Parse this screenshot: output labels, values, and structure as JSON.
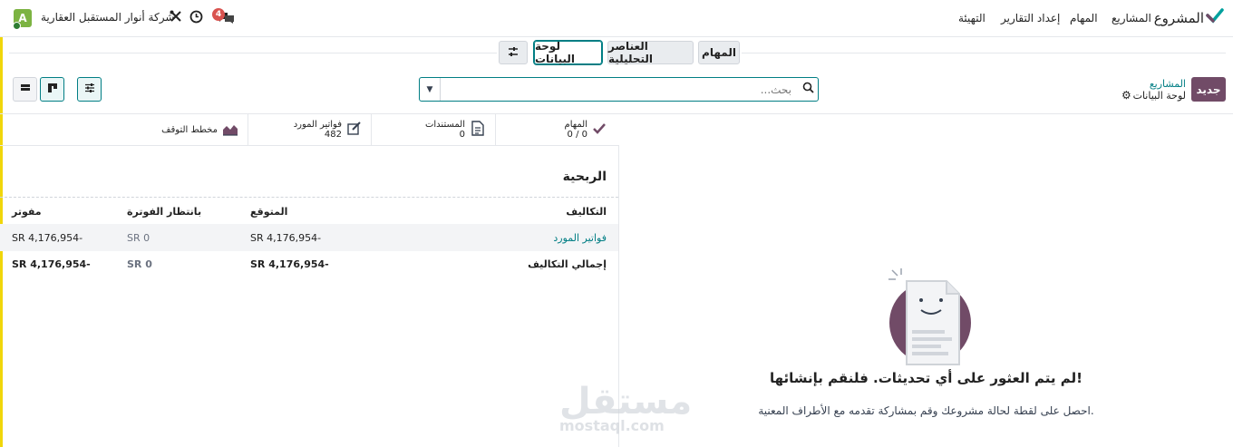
{
  "topbar": {
    "avatar_initial": "A",
    "company": "شركة أنوار المستقبل العقارية",
    "message_count": "4",
    "brand": "المشروع",
    "nav": [
      "المشاريع",
      "المهام",
      "إعداد التقارير",
      "التهيئة"
    ],
    "icons": [
      "messages-icon",
      "clock-icon",
      "tools-icon"
    ]
  },
  "view_tabs": {
    "tasks": "المهام",
    "analytic": "العناصر التحليلية",
    "dashboard": "لوحة البيانات",
    "settings_icon": "sliders-icon"
  },
  "control": {
    "new_button": "جديد",
    "breadcrumb_parent": "المشاريع",
    "breadcrumb_current": "لوحة البيانات",
    "search_placeholder": "بحث..."
  },
  "stats": [
    {
      "label": "المهام",
      "value": "0 / 0",
      "icon": "check-icon"
    },
    {
      "label": "المستندات",
      "value": "0",
      "icon": "document-icon"
    },
    {
      "label": "فواتير المورد",
      "value": "482",
      "icon": "edit-icon"
    },
    {
      "label": "مخطط التوقف",
      "value": "",
      "icon": "area-chart-icon"
    }
  ],
  "profitability": {
    "title": "الربحية",
    "headers": {
      "costs": "التكاليف",
      "expected": "المتوقع",
      "to_invoice": "بانتظار الفوترة",
      "invoiced": "مفوتر"
    },
    "rows": [
      {
        "label": "فواتير المورد",
        "expected": "SR 4,176,954-",
        "to_invoice": "SR 0",
        "invoiced": "SR 4,176,954-"
      }
    ],
    "total": {
      "label": "إجمالي التكاليف",
      "expected": "SR 4,176,954-",
      "to_invoice": "SR 0",
      "invoiced": "SR 4,176,954-"
    }
  },
  "updates": {
    "empty_title": "لم يتم العثور على أي تحديثات. فلنقم بإنشائها!",
    "empty_subtitle": "احصل على لقطة لحالة مشروعك وقم بمشاركة تقدمه مع الأطراف المعنية."
  },
  "watermark": {
    "arabic": "مستقل",
    "latin": "mostaql.com"
  },
  "colors": {
    "primary": "#714b67",
    "accent": "#017e84",
    "avatar": "#7cb342",
    "badge": "#d9534f"
  }
}
